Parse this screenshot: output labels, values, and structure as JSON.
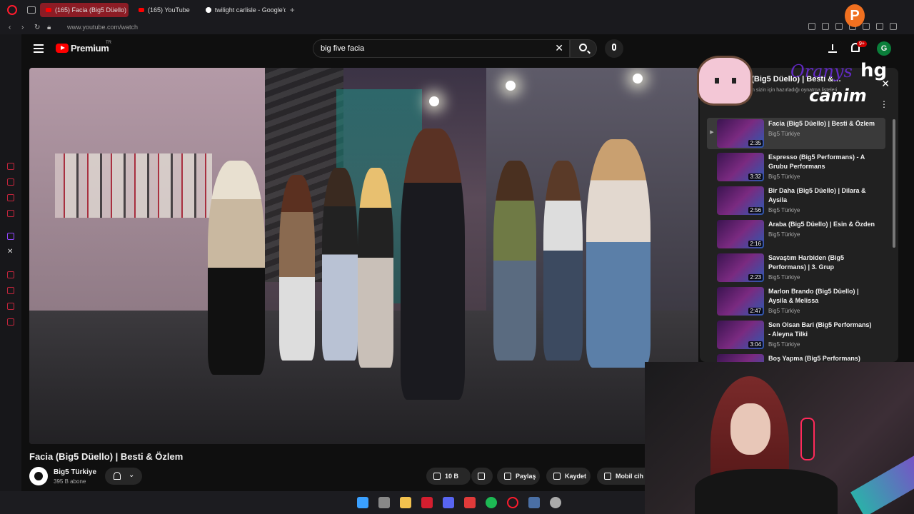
{
  "browser": {
    "tabs": [
      {
        "label": "(165) Facia (Big5 Düello) |",
        "active": true
      },
      {
        "label": "(165) YouTube",
        "active": false
      },
      {
        "label": "twilight carlisle - Google'd",
        "active": false
      }
    ],
    "url": "www.youtube.com/watch"
  },
  "youtube": {
    "logo": "Premium",
    "logo_region": "TR",
    "search_value": "big five facia",
    "notifications_badge": "9+",
    "avatar_letter": "G"
  },
  "video": {
    "title": "Facia (Big5 Düello) | Besti & Özlem",
    "channel": "Big5 Türkiye",
    "subscribers": "395 B abone",
    "likes": "10 B",
    "share_label": "Paylaş",
    "save_label": "Kaydet",
    "mobile_label": "Mobil cih"
  },
  "playlist": {
    "header_title": "ia (Big5 Düello) | Besti &…",
    "header_subtitle": "be'un sizin için hazırladığı oynatma listeleri",
    "items": [
      {
        "title": "Facia (Big5 Düello) | Besti & Özlem",
        "channel": "Big5 Türkiye",
        "duration": "2:35",
        "active": true
      },
      {
        "title": "Espresso (Big5 Performans) - A Grubu Performans",
        "channel": "Big5 Türkiye",
        "duration": "3:32"
      },
      {
        "title": "Bir Daha (Big5 Düello) | Dilara & Aysila",
        "channel": "Big5 Türkiye",
        "duration": "2:56"
      },
      {
        "title": "Araba (Big5 Düello) | Esin & Özden",
        "channel": "Big5 Türkiye",
        "duration": "2:16"
      },
      {
        "title": "Savaştım Harbiden (Big5 Performans) | 3. Grup",
        "channel": "Big5 Türkiye",
        "duration": "2:23"
      },
      {
        "title": "Marlon Brando (Big5 Düello) | Aysila & Melissa",
        "channel": "Big5 Türkiye",
        "duration": "2:47"
      },
      {
        "title": "Sen Olsan Bari (Big5 Performans) - Aleyna Tilki",
        "channel": "Big5 Türkiye",
        "duration": "3:04"
      },
      {
        "title": "Boş Yapma (Big5 Performans)",
        "channel": "",
        "duration": ""
      }
    ]
  },
  "overlay": {
    "name": "Oranys",
    "hg": "hg",
    "canim": "canim",
    "p_logo": "P"
  },
  "colors": {
    "accent": "#ff0000",
    "opera": "#ff1b2d",
    "purple_overlay": "#6a2bd6"
  }
}
